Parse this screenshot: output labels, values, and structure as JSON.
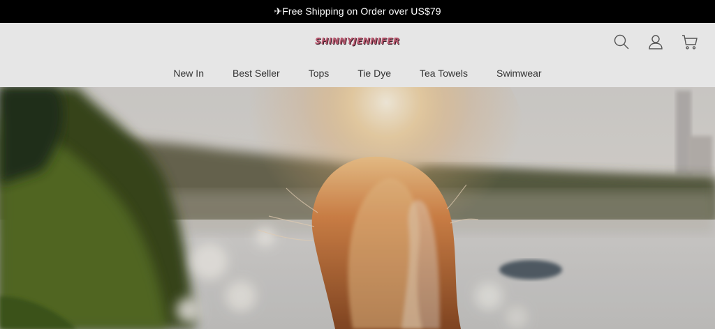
{
  "announcement": {
    "text": "✈Free Shipping on Order over US$79"
  },
  "header": {
    "logo_text": "SHINNYJENNIFER",
    "icons": [
      "search-icon",
      "account-icon",
      "cart-icon"
    ]
  },
  "nav": {
    "items": [
      {
        "label": "New In"
      },
      {
        "label": "Best Seller"
      },
      {
        "label": "Tops"
      },
      {
        "label": "Tie Dye"
      },
      {
        "label": "Tea Towels"
      },
      {
        "label": "Swimwear"
      }
    ]
  },
  "colors": {
    "announce_bg": "#000000",
    "header_bg": "#e6e6e6",
    "logo": "#b3576c"
  }
}
